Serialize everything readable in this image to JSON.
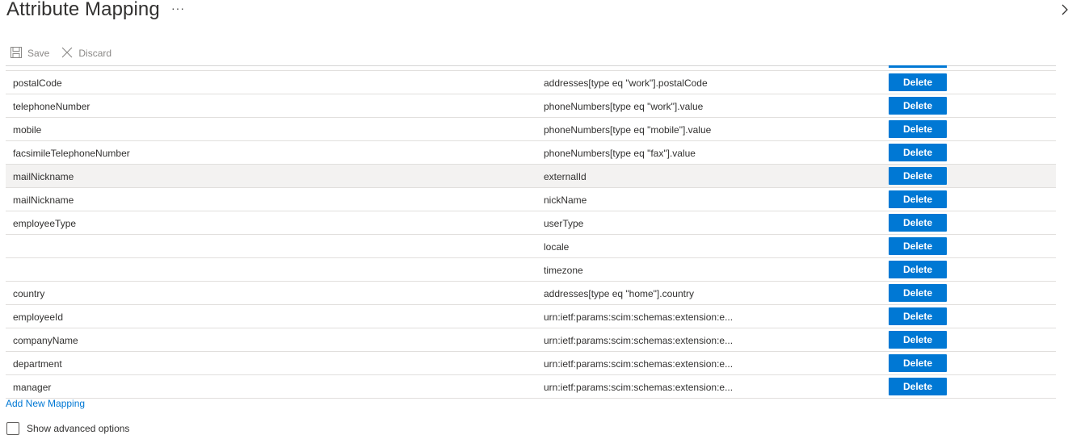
{
  "header": {
    "title": "Attribute Mapping",
    "more": "···"
  },
  "toolbar": {
    "save_label": "Save",
    "discard_label": "Discard"
  },
  "rows": [
    {
      "source": "postalCode",
      "target": "addresses[type eq \"work\"].postalCode",
      "action": "Delete"
    },
    {
      "source": "telephoneNumber",
      "target": "phoneNumbers[type eq \"work\"].value",
      "action": "Delete"
    },
    {
      "source": "mobile",
      "target": "phoneNumbers[type eq \"mobile\"].value",
      "action": "Delete"
    },
    {
      "source": "facsimileTelephoneNumber",
      "target": "phoneNumbers[type eq \"fax\"].value",
      "action": "Delete"
    },
    {
      "source": "mailNickname",
      "target": "externalId",
      "action": "Delete"
    },
    {
      "source": "mailNickname",
      "target": "nickName",
      "action": "Delete"
    },
    {
      "source": "employeeType",
      "target": "userType",
      "action": "Delete"
    },
    {
      "source": "",
      "target": "locale",
      "action": "Delete"
    },
    {
      "source": "",
      "target": "timezone",
      "action": "Delete"
    },
    {
      "source": "country",
      "target": "addresses[type eq \"home\"].country",
      "action": "Delete"
    },
    {
      "source": "employeeId",
      "target": "urn:ietf:params:scim:schemas:extension:e...",
      "action": "Delete"
    },
    {
      "source": "companyName",
      "target": "urn:ietf:params:scim:schemas:extension:e...",
      "action": "Delete"
    },
    {
      "source": "department",
      "target": "urn:ietf:params:scim:schemas:extension:e...",
      "action": "Delete"
    },
    {
      "source": "manager",
      "target": "urn:ietf:params:scim:schemas:extension:e...",
      "action": "Delete"
    }
  ],
  "add_mapping_label": "Add New Mapping",
  "advanced": {
    "label": "Show advanced options",
    "checked": false
  },
  "colors": {
    "accent": "#0078d4",
    "row_highlight": "#f3f2f1"
  }
}
